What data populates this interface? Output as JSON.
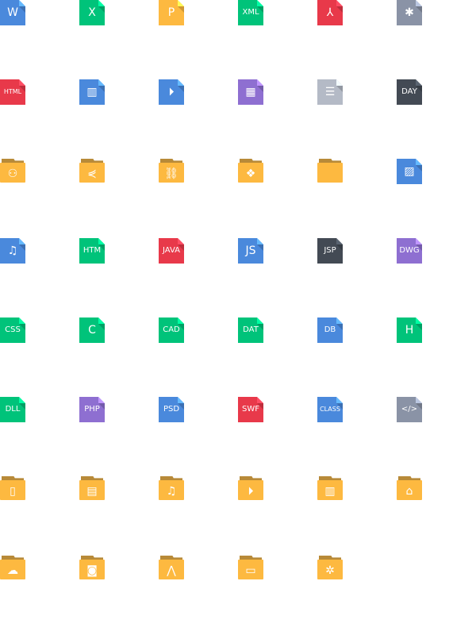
{
  "colors": {
    "blue": "#4A89DC",
    "green": "#00C37A",
    "yellow": "#FDB940",
    "red": "#E8394A",
    "gray": "#8A93A6",
    "lightgray": "#B4BAC6",
    "dark": "#434A54",
    "purple": "#8E6FD1"
  },
  "rows": [
    [
      {
        "kind": "file",
        "color": "blue",
        "label": "W",
        "size": "big"
      },
      {
        "kind": "file",
        "color": "green",
        "label": "X",
        "size": "big"
      },
      {
        "kind": "file",
        "color": "yellow",
        "label": "P",
        "size": "big"
      },
      {
        "kind": "file",
        "color": "green",
        "label": "XML"
      },
      {
        "kind": "file",
        "color": "red",
        "icon": "pdf-icon",
        "glyph": "⅄"
      },
      {
        "kind": "file",
        "color": "gray",
        "icon": "asterisk-icon",
        "glyph": "✱"
      }
    ],
    [
      {
        "kind": "file",
        "color": "red",
        "label": "HTML",
        "size": "small"
      },
      {
        "kind": "file",
        "color": "blue",
        "icon": "film-icon",
        "glyph": "▥"
      },
      {
        "kind": "file",
        "color": "blue",
        "icon": "play-icon",
        "glyph": "⏵"
      },
      {
        "kind": "file",
        "color": "purple",
        "icon": "archive-icon",
        "glyph": "▦"
      },
      {
        "kind": "file",
        "color": "lightgray",
        "icon": "text-lines-icon",
        "glyph": "☰"
      },
      {
        "kind": "file",
        "color": "dark",
        "label": "DAY"
      }
    ],
    [
      {
        "kind": "folder",
        "icon": "users-icon",
        "glyph": "⚇"
      },
      {
        "kind": "folder",
        "icon": "share-icon",
        "glyph": "⋞"
      },
      {
        "kind": "folder",
        "icon": "link-icon",
        "glyph": "⛓"
      },
      {
        "kind": "folder",
        "icon": "diamond-icon",
        "glyph": "❖"
      },
      {
        "kind": "folder",
        "icon": "folder-icon",
        "glyph": ""
      },
      {
        "kind": "file",
        "color": "blue",
        "icon": "image-icon",
        "glyph": "▨"
      }
    ],
    [
      {
        "kind": "file",
        "color": "blue",
        "icon": "music-icon",
        "glyph": "♫"
      },
      {
        "kind": "file",
        "color": "green",
        "label": "HTM"
      },
      {
        "kind": "file",
        "color": "red",
        "label": "JAVA"
      },
      {
        "kind": "file",
        "color": "blue",
        "label": "JS",
        "size": "big"
      },
      {
        "kind": "file",
        "color": "dark",
        "label": "JSP"
      },
      {
        "kind": "file",
        "color": "purple",
        "label": "DWG"
      }
    ],
    [
      {
        "kind": "file",
        "color": "green",
        "label": "CSS"
      },
      {
        "kind": "file",
        "color": "green",
        "label": "C",
        "size": "big"
      },
      {
        "kind": "file",
        "color": "green",
        "label": "CAD"
      },
      {
        "kind": "file",
        "color": "green",
        "label": "DAT"
      },
      {
        "kind": "file",
        "color": "blue",
        "label": "DB"
      },
      {
        "kind": "file",
        "color": "green",
        "label": "H",
        "size": "big"
      }
    ],
    [
      {
        "kind": "file",
        "color": "green",
        "label": "DLL"
      },
      {
        "kind": "file",
        "color": "purple",
        "label": "PHP"
      },
      {
        "kind": "file",
        "color": "blue",
        "label": "PSD"
      },
      {
        "kind": "file",
        "color": "red",
        "label": "SWF"
      },
      {
        "kind": "file",
        "color": "blue",
        "label": "CLASS",
        "size": "small"
      },
      {
        "kind": "file",
        "color": "gray",
        "label": "</>"
      }
    ],
    [
      {
        "kind": "folder",
        "icon": "phone-icon",
        "glyph": "▯"
      },
      {
        "kind": "folder",
        "icon": "document-icon",
        "glyph": "▤"
      },
      {
        "kind": "folder",
        "icon": "music-icon",
        "glyph": "♫"
      },
      {
        "kind": "folder",
        "icon": "play-icon",
        "glyph": "⏵"
      },
      {
        "kind": "folder",
        "icon": "book-icon",
        "glyph": "▥"
      },
      {
        "kind": "folder",
        "icon": "bag-icon",
        "glyph": "⌂"
      }
    ],
    [
      {
        "kind": "folder",
        "icon": "wechat-icon",
        "glyph": "☁"
      },
      {
        "kind": "folder",
        "icon": "camera-icon",
        "glyph": "◙"
      },
      {
        "kind": "folder",
        "icon": "mountain-icon",
        "glyph": "⋀"
      },
      {
        "kind": "folder",
        "icon": "video-icon",
        "glyph": "▭"
      },
      {
        "kind": "folder",
        "icon": "android-icon",
        "glyph": "✲"
      }
    ]
  ]
}
